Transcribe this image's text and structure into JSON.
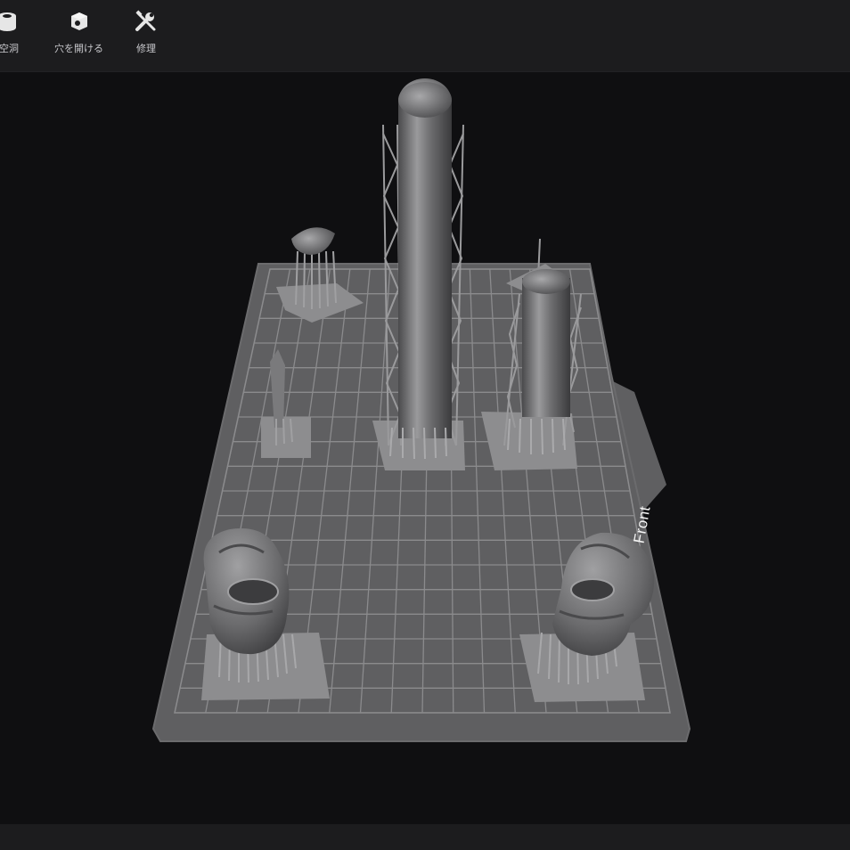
{
  "toolbar": {
    "tools": [
      {
        "label": "空洞",
        "icon": "hollow-icon"
      },
      {
        "label": "穴を開ける",
        "icon": "drill-hole-icon"
      },
      {
        "label": "修理",
        "icon": "repair-icon"
      }
    ]
  },
  "viewport": {
    "orientation_label": "Front",
    "colors": {
      "background": "#0f0f11",
      "plate": "#5f5f61",
      "grid": "#8a8a8c",
      "model": "#7c7c7e"
    }
  }
}
